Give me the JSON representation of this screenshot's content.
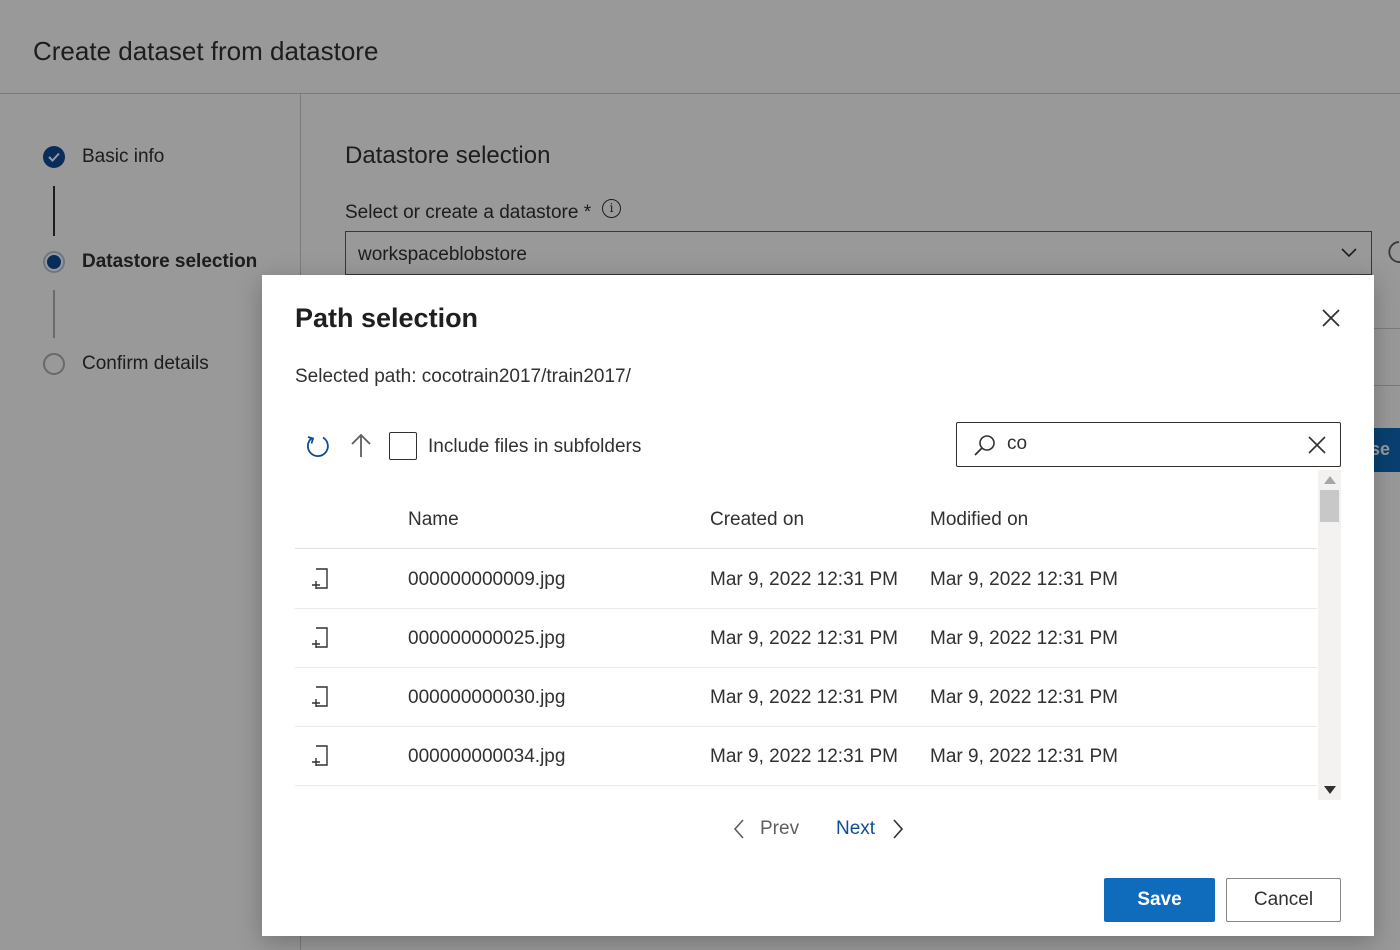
{
  "page": {
    "title": "Create dataset from datastore",
    "steps": [
      {
        "label": "Basic info",
        "state": "completed"
      },
      {
        "label": "Datastore selection",
        "state": "current"
      },
      {
        "label": "Confirm details",
        "state": "pending"
      }
    ],
    "section_title": "Datastore selection",
    "datastore_label": "Select or create a datastore *",
    "datastore_value": "workspaceblobstore",
    "browse_stub_text": "se"
  },
  "modal": {
    "title": "Path selection",
    "selected_path": "Selected path: cocotrain2017/train2017/",
    "toolbar": {
      "include_subfolders_label": "Include files in subfolders",
      "include_subfolders_checked": false
    },
    "search": {
      "value": "co",
      "placeholder": ""
    },
    "table": {
      "columns": [
        "Name",
        "Created on",
        "Modified on"
      ],
      "rows": [
        {
          "name": "000000000009.jpg",
          "created": "Mar 9, 2022 12:31 PM",
          "modified": "Mar 9, 2022 12:31 PM"
        },
        {
          "name": "000000000025.jpg",
          "created": "Mar 9, 2022 12:31 PM",
          "modified": "Mar 9, 2022 12:31 PM"
        },
        {
          "name": "000000000030.jpg",
          "created": "Mar 9, 2022 12:31 PM",
          "modified": "Mar 9, 2022 12:31 PM"
        },
        {
          "name": "000000000034.jpg",
          "created": "Mar 9, 2022 12:31 PM",
          "modified": "Mar 9, 2022 12:31 PM"
        }
      ]
    },
    "pager": {
      "prev_label": "Prev",
      "next_label": "Next"
    },
    "buttons": {
      "save_label": "Save",
      "cancel_label": "Cancel"
    }
  },
  "colors": {
    "accent": "#0f6cbd",
    "step_active": "#0f4c97",
    "link": "#0f4c97",
    "overlay": "rgba(0,0,0,0.40)"
  },
  "icons": [
    "check-circle-icon",
    "info-icon",
    "chevron-down-icon",
    "refresh-icon",
    "close-icon",
    "arrow-up-icon",
    "search-icon",
    "file-icon",
    "chevron-left-icon",
    "chevron-right-icon"
  ]
}
